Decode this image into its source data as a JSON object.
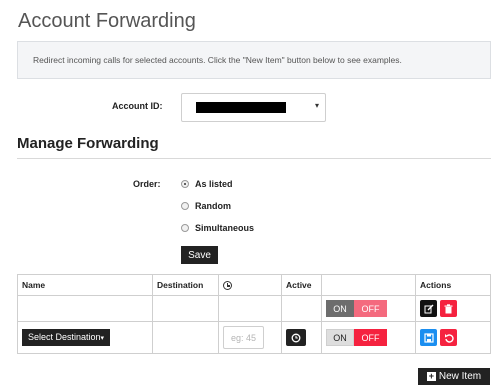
{
  "page": {
    "title": "Account Forwarding",
    "info": "Redirect incoming calls for selected accounts. Click the \"New Item\" button below to see examples."
  },
  "account": {
    "label": "Account ID:",
    "caret": "▾"
  },
  "manage": {
    "title": "Manage Forwarding"
  },
  "order": {
    "label": "Order:",
    "options": [
      "As listed",
      "Random",
      "Simultaneous"
    ],
    "selected": "As listed"
  },
  "save_label": "Save",
  "table": {
    "headers": {
      "name": "Name",
      "destination": "Destination",
      "time_icon": "clock-icon",
      "active": "Active",
      "toggle": "",
      "actions": "Actions"
    },
    "rows": [
      {
        "toggle_on": "ON",
        "toggle_off": "OFF",
        "state": "off",
        "actions": [
          "edit-icon",
          "trash-icon"
        ]
      },
      {
        "destination_button": "Select Destination",
        "timeout_placeholder": "eg: 45",
        "toggle_on": "ON",
        "toggle_off": "OFF",
        "state": "off",
        "actions": [
          "save-icon",
          "undo-icon"
        ]
      }
    ]
  },
  "new_item_label": "New Item",
  "colors": {
    "danger": "#f5223f",
    "danger_light": "#f46a7e",
    "primary": "#1a8ef0",
    "dark": "#222222"
  }
}
